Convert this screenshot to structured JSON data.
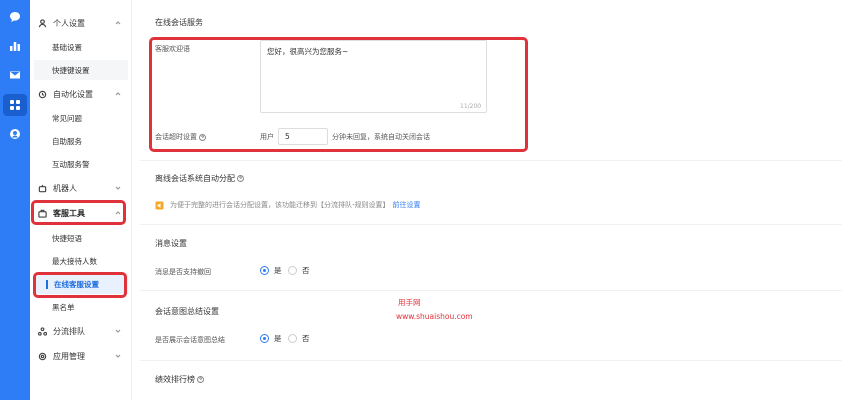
{
  "rail": {
    "icons": [
      "chat-icon",
      "chart-icon",
      "mail-icon",
      "apps-icon",
      "support-icon"
    ],
    "active_index": 3
  },
  "menu": {
    "personal": {
      "label": "个人设置",
      "items": [
        "基础设置",
        "快捷键设置"
      ]
    },
    "automation": {
      "label": "自动化设置",
      "items": [
        "常见问题",
        "自助服务",
        "互动服务警"
      ]
    },
    "robot": {
      "label": "机器人"
    },
    "tools": {
      "label": "客服工具",
      "items": [
        "快捷短语",
        "最大接待人数",
        "在线客服设置",
        "黑名单"
      ]
    },
    "routing": {
      "label": "分流排队"
    },
    "apps": {
      "label": "应用管理"
    }
  },
  "online": {
    "title": "在线会话服务",
    "welcome_label": "客服欢迎语",
    "welcome_value": "您好，很高兴为您服务~",
    "welcome_counter": "11/200",
    "timeout_label": "会话超时设置",
    "timeout_prefix": "用户",
    "timeout_value": "5",
    "timeout_suffix": "分钟未回复，系统自动关闭会话"
  },
  "offline": {
    "title": "离线会话系统自动分配",
    "notice": "为便于完整的进行会话分配设置，该功能迁移到【分流排队-规则设置】",
    "notice_link": "前往设置"
  },
  "message": {
    "title": "消息设置",
    "recall_label": "消息是否支持撤回",
    "yes": "是",
    "no": "否",
    "selected": "是"
  },
  "intent": {
    "title": "会话意图总结设置",
    "summary_label": "是否展示会话意图总结",
    "yes": "是",
    "no": "否",
    "selected": "是"
  },
  "performance": {
    "title": "绩效排行榜"
  },
  "watermark": {
    "line1": "用手网",
    "line2": "www.shuaishou.com"
  },
  "colors": {
    "primary": "#2f7df6",
    "highlight": "#e0323b"
  }
}
